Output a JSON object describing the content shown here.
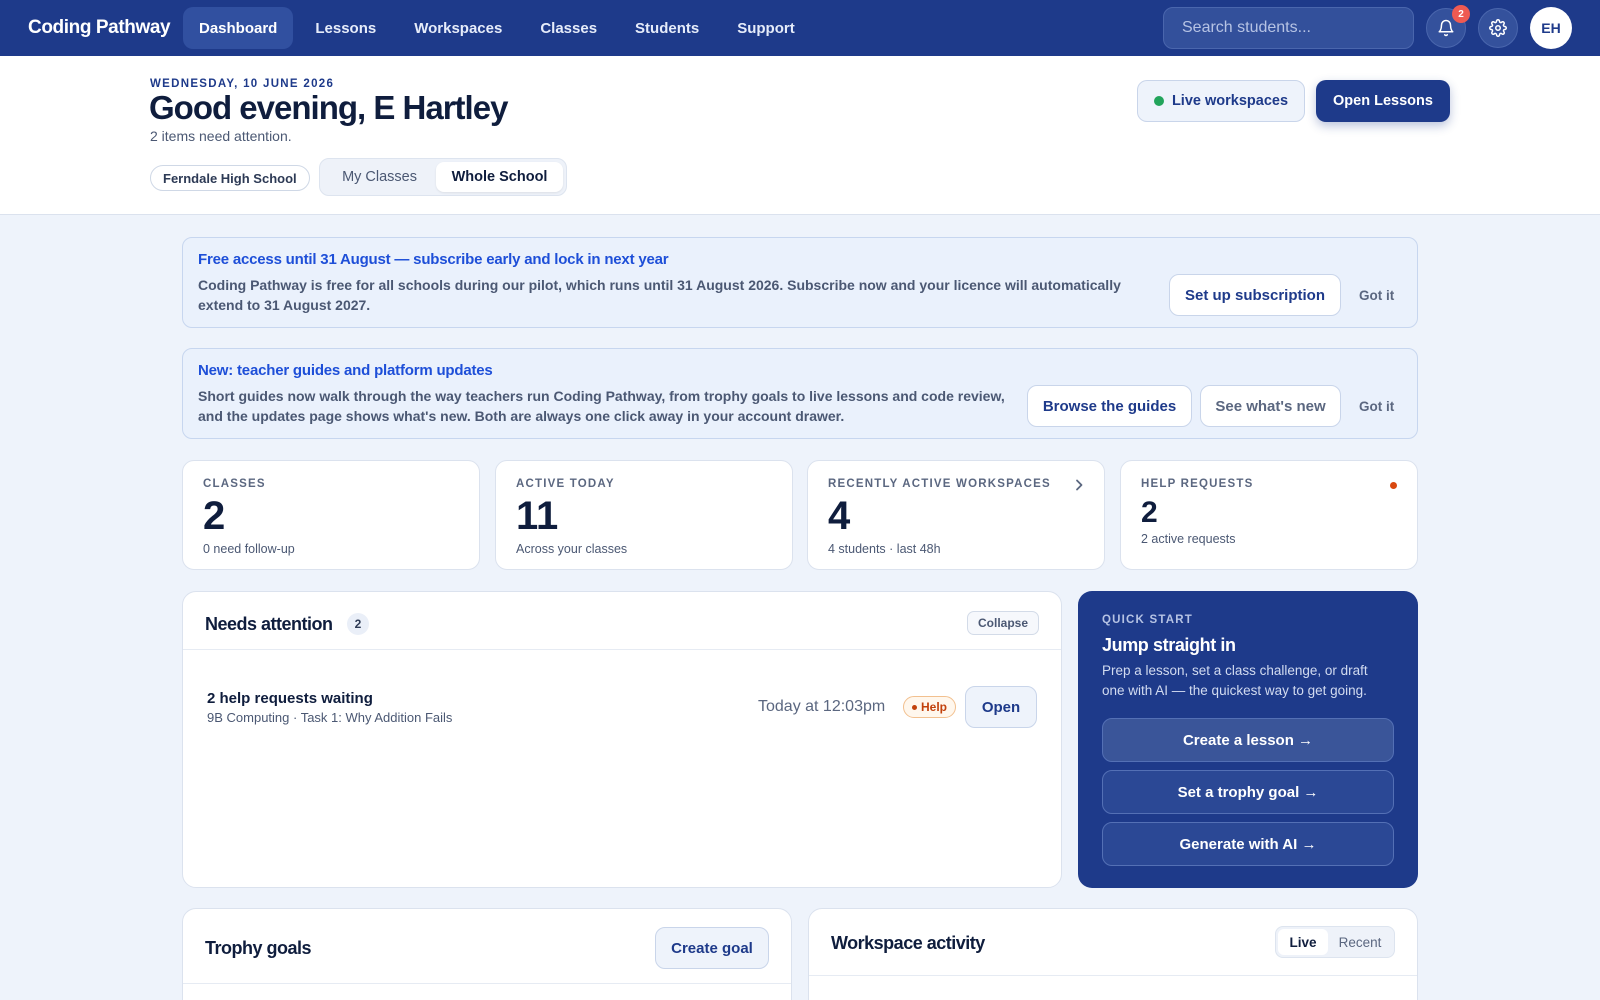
{
  "app": {
    "name": "Coding Pathway"
  },
  "nav": {
    "items": [
      "Dashboard",
      "Lessons",
      "Workspaces",
      "Classes",
      "Students",
      "Support"
    ],
    "search_placeholder": "Search students...",
    "notification_count": "2",
    "avatar_initials": "EH"
  },
  "header": {
    "date": "WEDNESDAY, 10 JUNE 2026",
    "greeting": "Good evening, E Hartley",
    "subtitle": "2 items need attention.",
    "school": "Ferndale High School",
    "scope_options": [
      "My Classes",
      "Whole School"
    ],
    "scope_selected": "Whole School",
    "live_workspaces_label": "Live workspaces",
    "open_lessons_label": "Open Lessons"
  },
  "banners": [
    {
      "title": "Free access until 31 August — subscribe early and lock in next year",
      "text": "Coding Pathway is free for all schools during our pilot, which runs until 31 August 2026. Subscribe now and your licence will automatically extend to 31 August 2027.",
      "primary_label": "Set up subscription",
      "dismiss_label": "Got it"
    },
    {
      "title": "New: teacher guides and platform updates",
      "text": "Short guides now walk through the way teachers run Coding Pathway, from trophy goals to live lessons and code review, and the updates page shows what's new. Both are always one click away in your account drawer.",
      "primary_label": "Browse the guides",
      "secondary_label": "See what's new",
      "dismiss_label": "Got it"
    }
  ],
  "stats": [
    {
      "label": "CLASSES",
      "value": "2",
      "sub": "0 need follow-up"
    },
    {
      "label": "ACTIVE TODAY",
      "value": "11",
      "sub": "Across your classes"
    },
    {
      "label": "RECENTLY ACTIVE WORKSPACES",
      "value": "4",
      "sub": "4 students · last 48h"
    },
    {
      "label": "HELP REQUESTS",
      "value": "2",
      "sub": "2 active requests"
    }
  ],
  "needs_attention": {
    "title": "Needs attention",
    "count": "2",
    "collapse_label": "Collapse",
    "items": [
      {
        "title": "2 help requests waiting",
        "meta": "9B Computing · Task 1: Why Addition Fails",
        "time": "Today at 12:03pm",
        "tag": "Help",
        "action": "Open"
      }
    ]
  },
  "quick_start": {
    "eyebrow": "QUICK START",
    "title": "Jump straight in",
    "text": "Prep a lesson, set a class challenge, or draft one with AI — the quickest way to get going.",
    "actions": [
      "Create a lesson →",
      "Set a trophy goal →",
      "Generate with AI →"
    ]
  },
  "trophy_goals": {
    "title": "Trophy goals",
    "create_label": "Create goal"
  },
  "workspace_activity": {
    "title": "Workspace activity",
    "tabs": [
      "Live",
      "Recent"
    ],
    "selected_tab": "Live"
  },
  "colors": {
    "brand": "#1e3a8a",
    "accent_link": "#1e4fd8",
    "help_tag": "#c2410c",
    "live_dot": "#22a45b",
    "alert_dot": "#d9480f"
  }
}
